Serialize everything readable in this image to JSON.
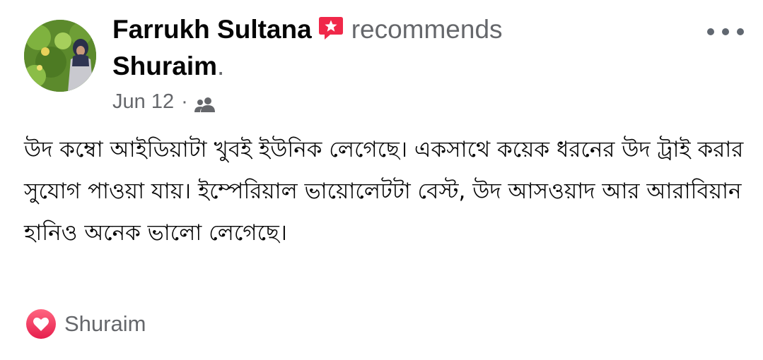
{
  "post": {
    "author": "Farrukh Sultana",
    "verb": "recommends",
    "page_name": "Shuraim",
    "page_suffix": ".",
    "date": "Jun 12",
    "separator": "·",
    "privacy_icon": "friends-icon",
    "body": "উদ কম্বো আইডিয়াটা খুবই ইউনিক লেগেছে। একসাথে কয়েক ধরনের উদ ট্রাই করার সুযোগ পাওয়া যায়। ইম্পেরিয়াল ভায়োলেটটা বেস্ট, উদ আসওয়াদ আর আরাবিয়ান হানিও অনেক ভালো লেগেছে।",
    "reaction_icon": "heart-icon",
    "reacted_by": "Shuraim"
  },
  "colors": {
    "recommend_badge": "#f02849",
    "reaction_heart": "#f33e58",
    "secondary_text": "#65676b"
  }
}
